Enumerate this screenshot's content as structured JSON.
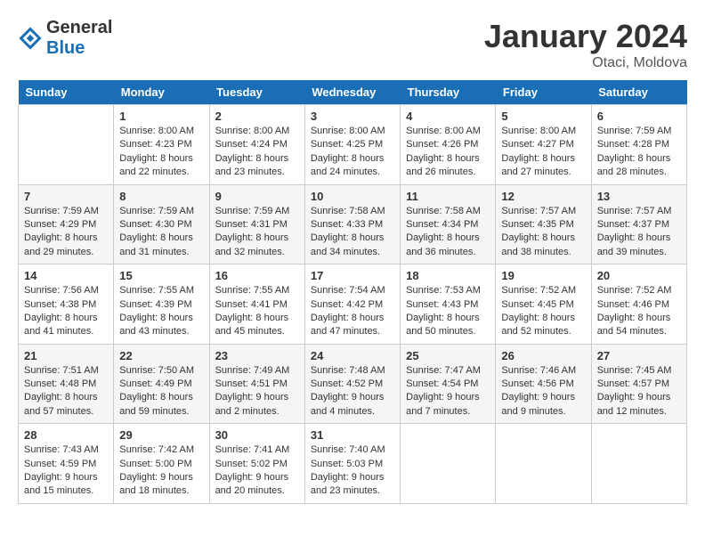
{
  "header": {
    "logo_line1": "General",
    "logo_line2": "Blue",
    "month": "January 2024",
    "location": "Otaci, Moldova"
  },
  "days_of_week": [
    "Sunday",
    "Monday",
    "Tuesday",
    "Wednesday",
    "Thursday",
    "Friday",
    "Saturday"
  ],
  "weeks": [
    [
      {
        "day": "",
        "info": ""
      },
      {
        "day": "1",
        "info": "Sunrise: 8:00 AM\nSunset: 4:23 PM\nDaylight: 8 hours\nand 22 minutes."
      },
      {
        "day": "2",
        "info": "Sunrise: 8:00 AM\nSunset: 4:24 PM\nDaylight: 8 hours\nand 23 minutes."
      },
      {
        "day": "3",
        "info": "Sunrise: 8:00 AM\nSunset: 4:25 PM\nDaylight: 8 hours\nand 24 minutes."
      },
      {
        "day": "4",
        "info": "Sunrise: 8:00 AM\nSunset: 4:26 PM\nDaylight: 8 hours\nand 26 minutes."
      },
      {
        "day": "5",
        "info": "Sunrise: 8:00 AM\nSunset: 4:27 PM\nDaylight: 8 hours\nand 27 minutes."
      },
      {
        "day": "6",
        "info": "Sunrise: 7:59 AM\nSunset: 4:28 PM\nDaylight: 8 hours\nand 28 minutes."
      }
    ],
    [
      {
        "day": "7",
        "info": "Sunrise: 7:59 AM\nSunset: 4:29 PM\nDaylight: 8 hours\nand 29 minutes."
      },
      {
        "day": "8",
        "info": "Sunrise: 7:59 AM\nSunset: 4:30 PM\nDaylight: 8 hours\nand 31 minutes."
      },
      {
        "day": "9",
        "info": "Sunrise: 7:59 AM\nSunset: 4:31 PM\nDaylight: 8 hours\nand 32 minutes."
      },
      {
        "day": "10",
        "info": "Sunrise: 7:58 AM\nSunset: 4:33 PM\nDaylight: 8 hours\nand 34 minutes."
      },
      {
        "day": "11",
        "info": "Sunrise: 7:58 AM\nSunset: 4:34 PM\nDaylight: 8 hours\nand 36 minutes."
      },
      {
        "day": "12",
        "info": "Sunrise: 7:57 AM\nSunset: 4:35 PM\nDaylight: 8 hours\nand 38 minutes."
      },
      {
        "day": "13",
        "info": "Sunrise: 7:57 AM\nSunset: 4:37 PM\nDaylight: 8 hours\nand 39 minutes."
      }
    ],
    [
      {
        "day": "14",
        "info": "Sunrise: 7:56 AM\nSunset: 4:38 PM\nDaylight: 8 hours\nand 41 minutes."
      },
      {
        "day": "15",
        "info": "Sunrise: 7:55 AM\nSunset: 4:39 PM\nDaylight: 8 hours\nand 43 minutes."
      },
      {
        "day": "16",
        "info": "Sunrise: 7:55 AM\nSunset: 4:41 PM\nDaylight: 8 hours\nand 45 minutes."
      },
      {
        "day": "17",
        "info": "Sunrise: 7:54 AM\nSunset: 4:42 PM\nDaylight: 8 hours\nand 47 minutes."
      },
      {
        "day": "18",
        "info": "Sunrise: 7:53 AM\nSunset: 4:43 PM\nDaylight: 8 hours\nand 50 minutes."
      },
      {
        "day": "19",
        "info": "Sunrise: 7:52 AM\nSunset: 4:45 PM\nDaylight: 8 hours\nand 52 minutes."
      },
      {
        "day": "20",
        "info": "Sunrise: 7:52 AM\nSunset: 4:46 PM\nDaylight: 8 hours\nand 54 minutes."
      }
    ],
    [
      {
        "day": "21",
        "info": "Sunrise: 7:51 AM\nSunset: 4:48 PM\nDaylight: 8 hours\nand 57 minutes."
      },
      {
        "day": "22",
        "info": "Sunrise: 7:50 AM\nSunset: 4:49 PM\nDaylight: 8 hours\nand 59 minutes."
      },
      {
        "day": "23",
        "info": "Sunrise: 7:49 AM\nSunset: 4:51 PM\nDaylight: 9 hours\nand 2 minutes."
      },
      {
        "day": "24",
        "info": "Sunrise: 7:48 AM\nSunset: 4:52 PM\nDaylight: 9 hours\nand 4 minutes."
      },
      {
        "day": "25",
        "info": "Sunrise: 7:47 AM\nSunset: 4:54 PM\nDaylight: 9 hours\nand 7 minutes."
      },
      {
        "day": "26",
        "info": "Sunrise: 7:46 AM\nSunset: 4:56 PM\nDaylight: 9 hours\nand 9 minutes."
      },
      {
        "day": "27",
        "info": "Sunrise: 7:45 AM\nSunset: 4:57 PM\nDaylight: 9 hours\nand 12 minutes."
      }
    ],
    [
      {
        "day": "28",
        "info": "Sunrise: 7:43 AM\nSunset: 4:59 PM\nDaylight: 9 hours\nand 15 minutes."
      },
      {
        "day": "29",
        "info": "Sunrise: 7:42 AM\nSunset: 5:00 PM\nDaylight: 9 hours\nand 18 minutes."
      },
      {
        "day": "30",
        "info": "Sunrise: 7:41 AM\nSunset: 5:02 PM\nDaylight: 9 hours\nand 20 minutes."
      },
      {
        "day": "31",
        "info": "Sunrise: 7:40 AM\nSunset: 5:03 PM\nDaylight: 9 hours\nand 23 minutes."
      },
      {
        "day": "",
        "info": ""
      },
      {
        "day": "",
        "info": ""
      },
      {
        "day": "",
        "info": ""
      }
    ]
  ]
}
